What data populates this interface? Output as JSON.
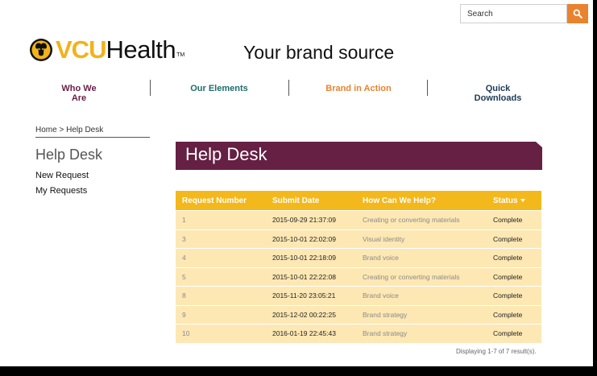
{
  "header": {
    "search_placeholder": "Search",
    "search_icon": "magnifier-icon",
    "accent": "#e9832e"
  },
  "logo": {
    "vcu": "VCU",
    "health": "Health",
    "tm": "TM",
    "mark_icon": "ram-head-logo-icon",
    "gold": "#f2b21a"
  },
  "tagline": "Your brand source",
  "nav": {
    "items": [
      {
        "label": "Who We Are",
        "color": "#6a1e4a"
      },
      {
        "label": "Our Elements",
        "color": "#1f6d6d"
      },
      {
        "label": "Brand in Action",
        "color": "#e9832e"
      },
      {
        "label": "Quick Downloads",
        "color": "#1c3a57"
      }
    ]
  },
  "sidebar": {
    "breadcrumb_home": "Home",
    "breadcrumb_separator": ">",
    "breadcrumb_current": "Help Desk",
    "title": "Help Desk",
    "links": [
      "New Request",
      "My Requests"
    ]
  },
  "banner": {
    "title": "Help Desk",
    "color": "#652044"
  },
  "table": {
    "columns": [
      "Request Number",
      "Submit Date",
      "How Can We Help?",
      "Status"
    ],
    "header_color": "#f3b81c",
    "row_color": "#fde8b4",
    "rows": [
      [
        "1",
        "2015-09-29 21:37:09",
        "Creating or converting materials",
        "Complete"
      ],
      [
        "3",
        "2015-10-01 22:02:09",
        "Visual identity",
        "Complete"
      ],
      [
        "4",
        "2015-10-01 22:18:09",
        "Brand voice",
        "Complete"
      ],
      [
        "5",
        "2015-10-01 22:22:08",
        "Creating or converting materials",
        "Complete"
      ],
      [
        "8",
        "2015-11-20 23:05:21",
        "Brand voice",
        "Complete"
      ],
      [
        "9",
        "2015-12-02 00:22:25",
        "Brand strategy",
        "Complete"
      ],
      [
        "10",
        "2016-01-19 22:45:43",
        "Brand strategy",
        "Complete"
      ]
    ],
    "footer": "Displaying 1-7 of 7 result(s)."
  }
}
